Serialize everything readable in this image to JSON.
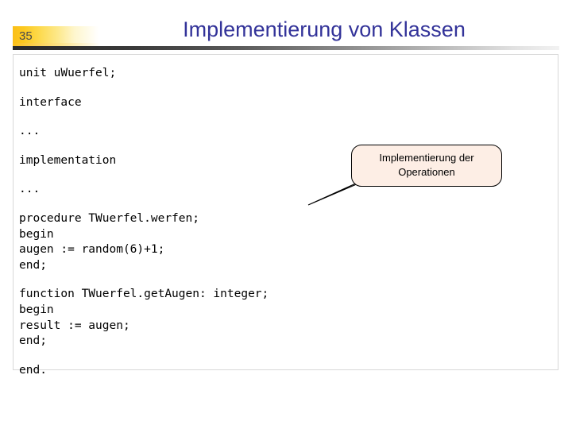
{
  "header": {
    "page_number": "35",
    "title": "Implementierung von Klassen",
    "title_color": "#333399",
    "badge_color": "#fcc01a"
  },
  "content": {
    "code_blocks": [
      {
        "lines": [
          "unit uWuerfel;"
        ]
      },
      {
        "lines": [
          "interface"
        ]
      },
      {
        "lines": [
          "..."
        ]
      },
      {
        "lines": [
          "implementation"
        ]
      },
      {
        "lines": [
          "..."
        ]
      },
      {
        "lines": [
          "procedure TWuerfel.werfen;",
          "begin",
          "augen := random(6)+1;",
          "end;"
        ]
      },
      {
        "lines": [
          "function TWuerfel.getAugen: integer;",
          "begin",
          "result := augen;",
          "end;"
        ]
      },
      {
        "lines": [
          "end."
        ]
      }
    ]
  },
  "callout": {
    "line1": "Implementierung der",
    "line2": "Operationen",
    "fill_color": "#fdeee5",
    "border_color": "#000000"
  }
}
